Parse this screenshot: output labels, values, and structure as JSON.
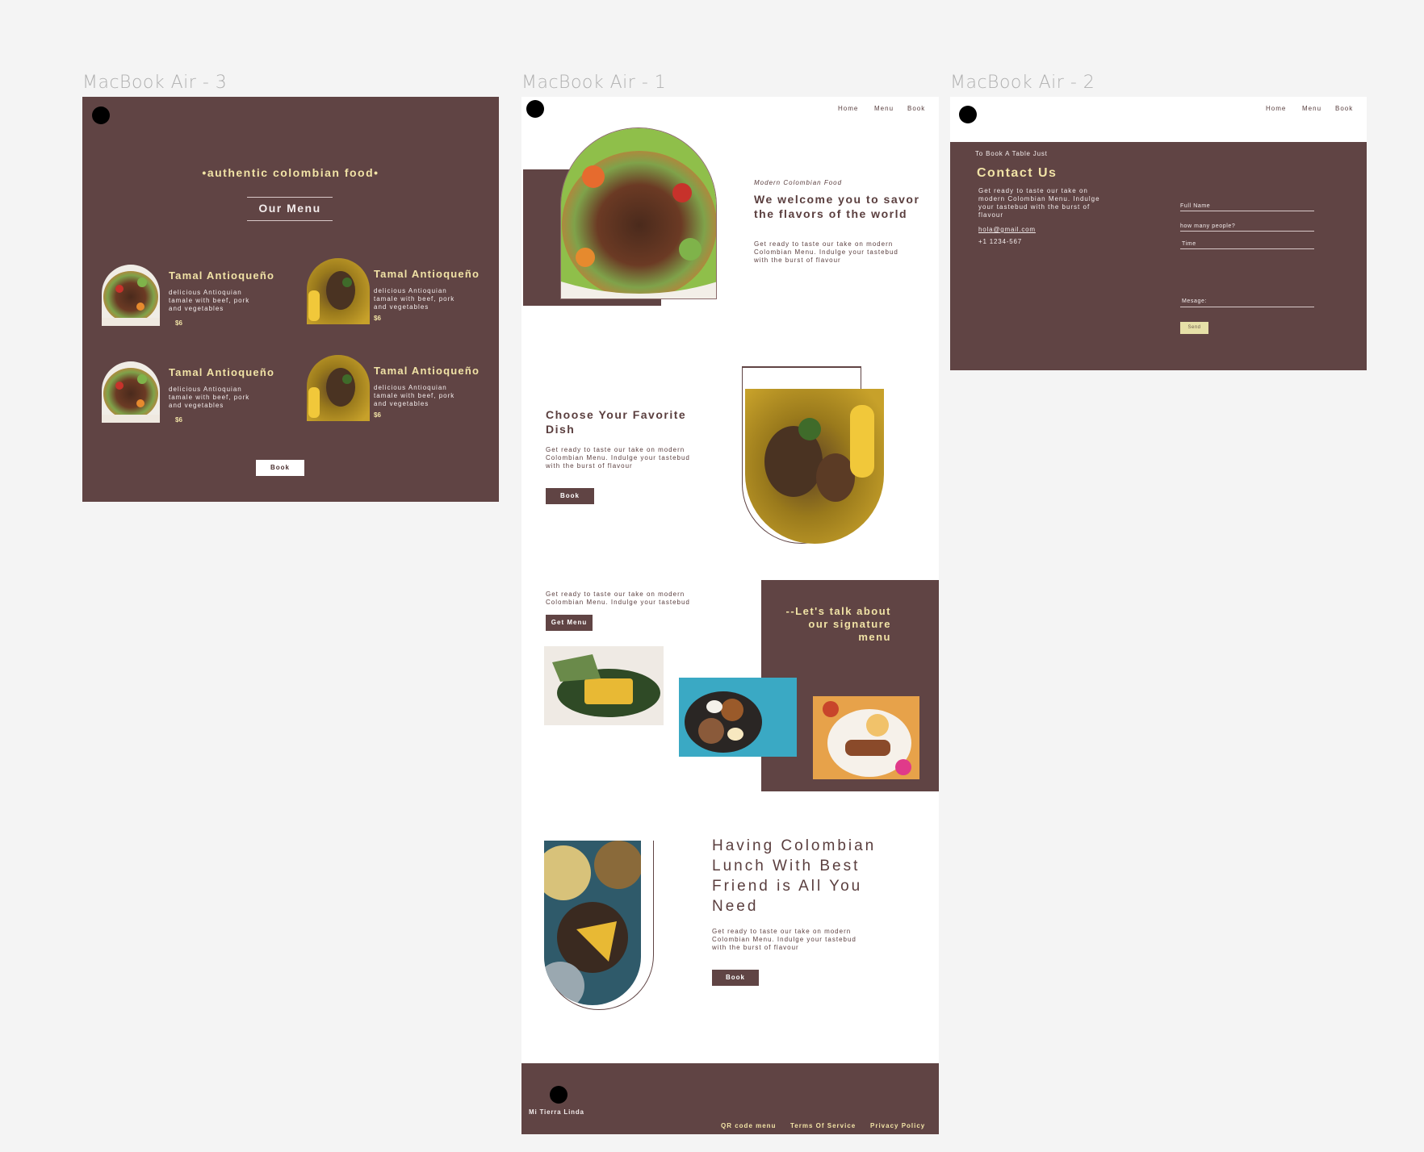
{
  "frames": {
    "menu_label": "MacBook Air - 3",
    "home_label": "MacBook Air - 1",
    "contact_label": "MacBook Air - 2"
  },
  "menu_page": {
    "tagline": "•authentic colombian food•",
    "heading": "Our Menu",
    "items": [
      {
        "name": "Tamal Antioqueño",
        "desc": "delicious Antioquian tamale with beef, pork and vegetables",
        "price": "$6",
        "icon": "salad-plate-image"
      },
      {
        "name": "Tamal Antioqueño",
        "desc": "delicious Antioquian tamale with beef, pork and vegetables",
        "price": "$6",
        "icon": "stew-corn-image"
      },
      {
        "name": "Tamal Antioqueño",
        "desc": "delicious Antioquian tamale with beef, pork and vegetables",
        "price": "$6",
        "icon": "salad-plate-image"
      },
      {
        "name": "Tamal Antioqueño",
        "desc": "delicious Antioquian tamale with beef, pork and vegetables",
        "price": "$6",
        "icon": "stew-corn-image"
      }
    ],
    "book_label": "Book"
  },
  "nav": {
    "home": "Home",
    "menu": "Menu",
    "book": "Book"
  },
  "home_page": {
    "hero": {
      "eyebrow": "Modern Colombian Food",
      "title": "We welcome you to savor the flavors of the world",
      "body": "Get ready to taste our  take  on modern Colombian Menu. Indulge  your tastebud with the burst of flavour"
    },
    "choose": {
      "title": "Choose Your Favorite Dish",
      "body": "Get ready to taste our  take  on modern Colombian Menu. Indulge  your tastebud with the burst of flavour",
      "button": "Book"
    },
    "signature": {
      "body": "Get ready to taste our  take  on modern Colombian Menu. Indulge  your tastebud",
      "button": "Get Menu",
      "heading": "--Let's talk about our signature menu"
    },
    "lunch": {
      "title": "Having Colombian Lunch With Best Friend is All You Need",
      "body": "Get ready to taste our  take  on modern Colombian Menu. Indulge  your tastebud with the burst of flavour",
      "button": "Book"
    },
    "footer": {
      "brand": "Mi Tierra Linda",
      "links": [
        "QR code menu",
        "Terms Of Service",
        "Privacy Policy"
      ]
    }
  },
  "contact_page": {
    "eyebrow": "To Book A Table Just",
    "title": "Contact Us",
    "body": "Get ready to taste our  take  on modern Colombian Menu. Indulge your tastebud with the burst of flavour",
    "email": "hola@gmail.com",
    "phone": "+1 1234-567",
    "fields": {
      "name": "Full Name",
      "people": "how many people?",
      "time": "Time",
      "message": "Mesage:"
    },
    "send": "Send"
  },
  "colors": {
    "brown": "#604444",
    "cream": "#f1e3a6",
    "white": "#ffffff",
    "background": "#f4f4f4"
  }
}
